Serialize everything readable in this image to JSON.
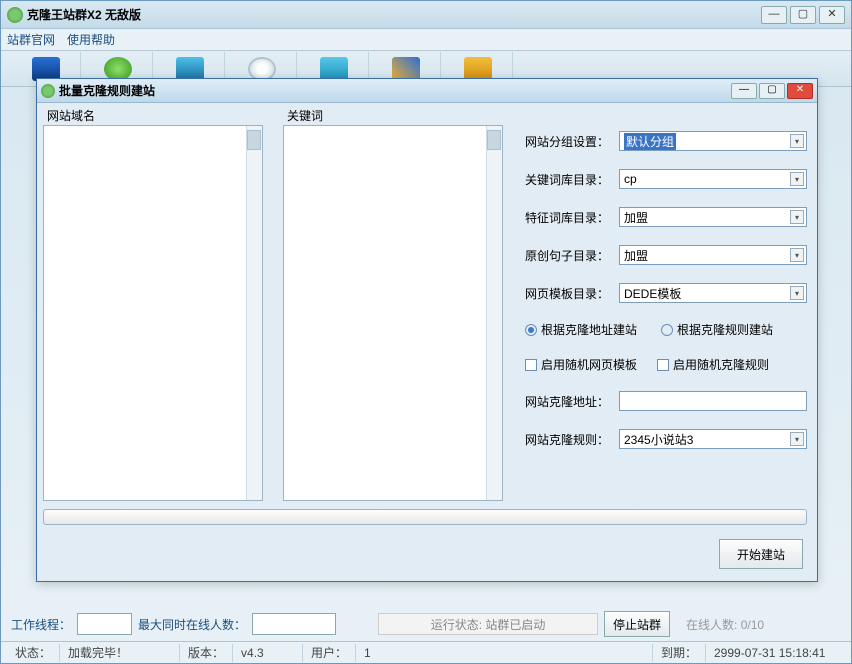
{
  "main": {
    "title": "克隆王站群X2  无敌版",
    "menu": {
      "item1": "站群官网",
      "item2": "使用帮助"
    }
  },
  "dialog": {
    "title": "批量克隆规则建站",
    "col1": "网站域名",
    "col2": "关键词",
    "form": {
      "l1": "网站分组设置：",
      "v1": "默认分组",
      "l2": "关键词库目录：",
      "v2": "cp",
      "l3": "特征词库目录：",
      "v3": "加盟",
      "l4": "原创句子目录：",
      "v4": "加盟",
      "l5": "网页模板目录：",
      "v5": "DEDE模板",
      "radio1": "根据克隆地址建站",
      "radio2": "根据克隆规则建站",
      "chk1": "启用随机网页模板",
      "chk2": "启用随机克隆规则",
      "l6": "网站克隆地址：",
      "v6": "",
      "l7": "网站克隆规则：",
      "v7": "2345小说站3"
    },
    "start_btn": "开始建站"
  },
  "bottom": {
    "work_thread": "工作线程：",
    "max_online": "最大同时在线人数：",
    "run_status": "运行状态: 站群已启动",
    "stop_btn": "停止站群",
    "online": "在线人数: 0/10"
  },
  "status": {
    "s1": "状态：",
    "s2": "加载完毕！",
    "s3": "版本：",
    "s4": "v4.3",
    "s5": "用户：",
    "s6": "1",
    "s7": "到期：",
    "s8": "2999-07-31 15:18:41"
  }
}
